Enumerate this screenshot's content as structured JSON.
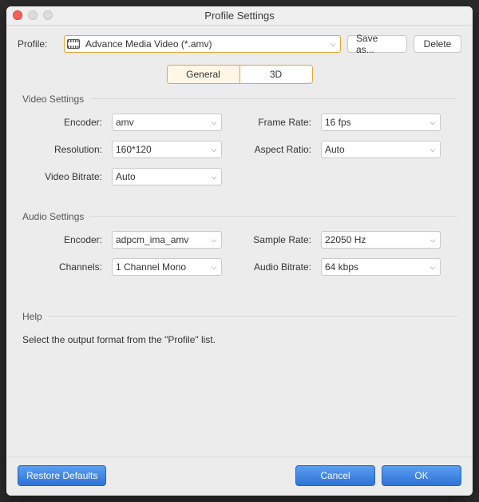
{
  "window": {
    "title": "Profile Settings"
  },
  "profile": {
    "label": "Profile:",
    "selected": "Advance Media Video (*.amv)",
    "save_as": "Save as...",
    "delete": "Delete"
  },
  "tabs": {
    "general": "General",
    "three_d": "3D",
    "active": "general"
  },
  "video": {
    "legend": "Video Settings",
    "encoder_label": "Encoder:",
    "encoder_value": "amv",
    "frame_rate_label": "Frame Rate:",
    "frame_rate_value": "16 fps",
    "resolution_label": "Resolution:",
    "resolution_value": "160*120",
    "aspect_label": "Aspect Ratio:",
    "aspect_value": "Auto",
    "bitrate_label": "Video Bitrate:",
    "bitrate_value": "Auto"
  },
  "audio": {
    "legend": "Audio Settings",
    "encoder_label": "Encoder:",
    "encoder_value": "adpcm_ima_amv",
    "sample_rate_label": "Sample Rate:",
    "sample_rate_value": "22050 Hz",
    "channels_label": "Channels:",
    "channels_value": "1 Channel Mono",
    "bitrate_label": "Audio Bitrate:",
    "bitrate_value": "64 kbps"
  },
  "help": {
    "legend": "Help",
    "text": "Select the output format from the \"Profile\" list."
  },
  "footer": {
    "restore": "Restore Defaults",
    "cancel": "Cancel",
    "ok": "OK"
  }
}
